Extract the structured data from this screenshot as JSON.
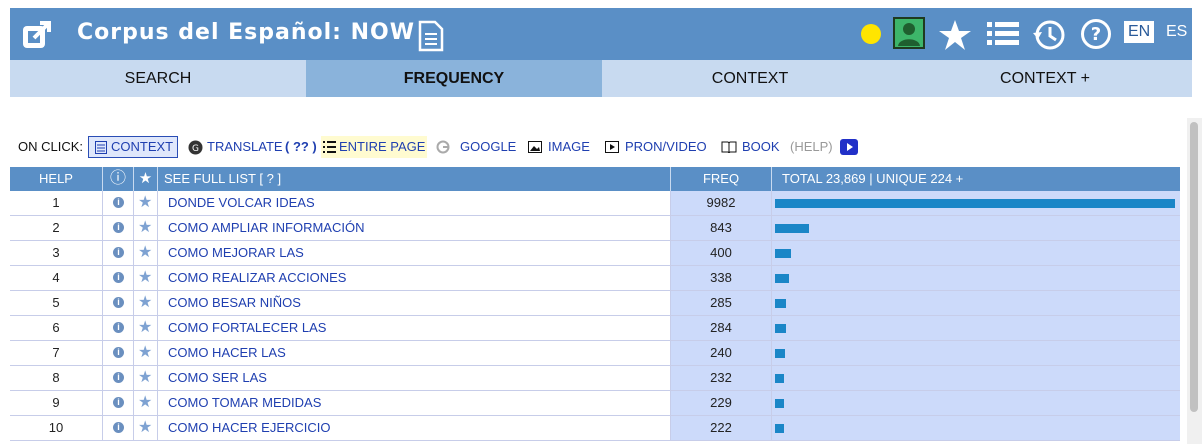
{
  "app": {
    "title": "Corpus del Español: NOW",
    "lang_en": "EN",
    "lang_es": "ES",
    "icons": [
      "external-link-icon",
      "document-icon",
      "status-dot",
      "user-icon",
      "star-icon",
      "list-icon",
      "history-icon",
      "help-icon"
    ]
  },
  "tabs": [
    {
      "label": "SEARCH"
    },
    {
      "label": "FREQUENCY"
    },
    {
      "label": "CONTEXT"
    },
    {
      "label": "CONTEXT +"
    }
  ],
  "onclick": {
    "label": "ON CLICK:",
    "context": "CONTEXT",
    "translate": "TRANSLATE",
    "translate_help": "( ?? )",
    "entire_page": "ENTIRE PAGE",
    "google": "GOOGLE",
    "image": "IMAGE",
    "pron_video": "PRON/VIDEO",
    "book": "BOOK",
    "help": "(HELP)"
  },
  "table": {
    "headers": {
      "help": "HELP",
      "info": "ⓘ",
      "star": "★",
      "see_full_list": "SEE FULL LIST  [ ? ]",
      "freq": "FREQ",
      "total": "TOTAL 23,869  |  UNIQUE 224  +"
    },
    "rows": [
      {
        "n": "1",
        "word": "DONDE VOLCAR IDEAS",
        "freq": "9982",
        "value": 9982
      },
      {
        "n": "2",
        "word": "COMO AMPLIAR INFORMACIÓN",
        "freq": "843",
        "value": 843
      },
      {
        "n": "3",
        "word": "COMO MEJORAR LAS",
        "freq": "400",
        "value": 400
      },
      {
        "n": "4",
        "word": "COMO REALIZAR ACCIONES",
        "freq": "338",
        "value": 338
      },
      {
        "n": "5",
        "word": "COMO BESAR NIÑOS",
        "freq": "285",
        "value": 285
      },
      {
        "n": "6",
        "word": "COMO FORTALECER LAS",
        "freq": "284",
        "value": 284
      },
      {
        "n": "7",
        "word": "COMO HACER LAS",
        "freq": "240",
        "value": 240
      },
      {
        "n": "8",
        "word": "COMO SER LAS",
        "freq": "232",
        "value": 232
      },
      {
        "n": "9",
        "word": "COMO TOMAR MEDIDAS",
        "freq": "229",
        "value": 229
      },
      {
        "n": "10",
        "word": "COMO HACER EJERCICIO",
        "freq": "222",
        "value": 222
      }
    ]
  },
  "colors": {
    "header": "#5a8fc6",
    "tab_bg": "#c8daf0",
    "tab_active": "#8ab3db",
    "bar": "#1a86c7",
    "freq_bg": "#ccdafa"
  }
}
